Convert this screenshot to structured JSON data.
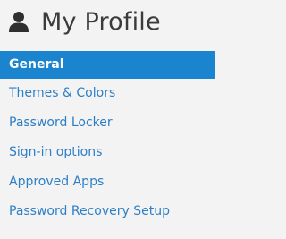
{
  "header": {
    "title": "My Profile",
    "icon": "user-icon"
  },
  "nav": {
    "items": [
      {
        "label": "General",
        "active": true
      },
      {
        "label": "Themes & Colors",
        "active": false
      },
      {
        "label": "Password Locker",
        "active": false
      },
      {
        "label": "Sign-in options",
        "active": false
      },
      {
        "label": "Approved Apps",
        "active": false
      },
      {
        "label": "Password Recovery Setup",
        "active": false
      }
    ]
  },
  "colors": {
    "accent": "#1a84cf",
    "link": "#2d7fc6",
    "background": "#f3f3f3",
    "title": "#3b3b3b"
  }
}
